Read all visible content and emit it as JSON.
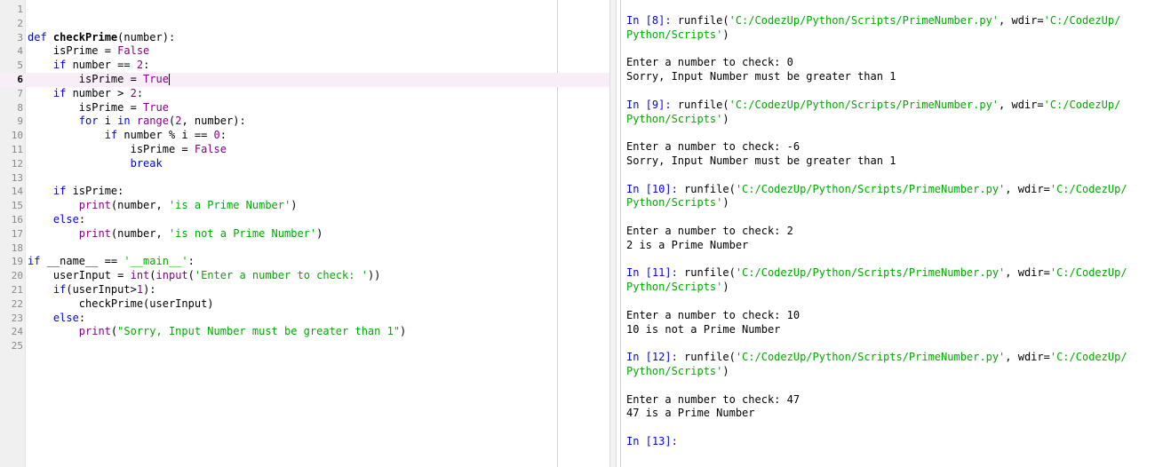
{
  "editor": {
    "lines": [
      {
        "n": "1",
        "parts": []
      },
      {
        "n": "2",
        "parts": []
      },
      {
        "n": "3",
        "parts": [
          [
            "kw",
            "def "
          ],
          [
            "fn",
            "checkPrime"
          ],
          [
            "t",
            "(number):"
          ]
        ]
      },
      {
        "n": "4",
        "parts": [
          [
            "t",
            "    isPrime = "
          ],
          [
            "bi",
            "False"
          ]
        ]
      },
      {
        "n": "5",
        "parts": [
          [
            "t",
            "    "
          ],
          [
            "kw",
            "if"
          ],
          [
            "t",
            " number == "
          ],
          [
            "num",
            "2"
          ],
          [
            "t",
            ":"
          ]
        ]
      },
      {
        "n": "6",
        "current": true,
        "parts": [
          [
            "t",
            "        isPrime = "
          ],
          [
            "bi",
            "True"
          ]
        ]
      },
      {
        "n": "7",
        "parts": [
          [
            "t",
            "    "
          ],
          [
            "kw",
            "if"
          ],
          [
            "t",
            " number > "
          ],
          [
            "num",
            "2"
          ],
          [
            "t",
            ":"
          ]
        ]
      },
      {
        "n": "8",
        "parts": [
          [
            "t",
            "        isPrime = "
          ],
          [
            "bi",
            "True"
          ]
        ]
      },
      {
        "n": "9",
        "parts": [
          [
            "t",
            "        "
          ],
          [
            "kw",
            "for"
          ],
          [
            "t",
            " i "
          ],
          [
            "kw",
            "in"
          ],
          [
            "t",
            " "
          ],
          [
            "bi",
            "range"
          ],
          [
            "t",
            "("
          ],
          [
            "num",
            "2"
          ],
          [
            "t",
            ", number):"
          ]
        ]
      },
      {
        "n": "10",
        "parts": [
          [
            "t",
            "            "
          ],
          [
            "kw",
            "if"
          ],
          [
            "t",
            " number % i == "
          ],
          [
            "num",
            "0"
          ],
          [
            "t",
            ":"
          ]
        ]
      },
      {
        "n": "11",
        "parts": [
          [
            "t",
            "                isPrime = "
          ],
          [
            "bi",
            "False"
          ]
        ]
      },
      {
        "n": "12",
        "parts": [
          [
            "t",
            "                "
          ],
          [
            "kw",
            "break"
          ]
        ]
      },
      {
        "n": "13",
        "parts": []
      },
      {
        "n": "14",
        "parts": [
          [
            "t",
            "    "
          ],
          [
            "kw",
            "if"
          ],
          [
            "t",
            " isPrime:"
          ]
        ]
      },
      {
        "n": "15",
        "parts": [
          [
            "t",
            "        "
          ],
          [
            "bi",
            "print"
          ],
          [
            "t",
            "(number, "
          ],
          [
            "str",
            "'is a Prime Number'"
          ],
          [
            "t",
            ")"
          ]
        ]
      },
      {
        "n": "16",
        "parts": [
          [
            "t",
            "    "
          ],
          [
            "kw",
            "else"
          ],
          [
            "t",
            ":"
          ]
        ]
      },
      {
        "n": "17",
        "parts": [
          [
            "t",
            "        "
          ],
          [
            "bi",
            "print"
          ],
          [
            "t",
            "(number, "
          ],
          [
            "str",
            "'is not a Prime Number'"
          ],
          [
            "t",
            ")"
          ]
        ]
      },
      {
        "n": "18",
        "parts": []
      },
      {
        "n": "19",
        "parts": [
          [
            "kw",
            "if"
          ],
          [
            "t",
            " __name__ == "
          ],
          [
            "str",
            "'__main__'"
          ],
          [
            "t",
            ":"
          ]
        ]
      },
      {
        "n": "20",
        "parts": [
          [
            "t",
            "    userInput = "
          ],
          [
            "bi",
            "int"
          ],
          [
            "t",
            "("
          ],
          [
            "bi",
            "input"
          ],
          [
            "t",
            "("
          ],
          [
            "str",
            "'Enter a number to check: '"
          ],
          [
            "t",
            "))"
          ]
        ]
      },
      {
        "n": "21",
        "parts": [
          [
            "t",
            "    "
          ],
          [
            "kw",
            "if"
          ],
          [
            "t",
            "(userInput>"
          ],
          [
            "num",
            "1"
          ],
          [
            "t",
            "):"
          ]
        ]
      },
      {
        "n": "22",
        "parts": [
          [
            "t",
            "        checkPrime(userInput)"
          ]
        ]
      },
      {
        "n": "23",
        "parts": [
          [
            "t",
            "    "
          ],
          [
            "kw",
            "else"
          ],
          [
            "t",
            ":"
          ]
        ]
      },
      {
        "n": "24",
        "parts": [
          [
            "t",
            "        "
          ],
          [
            "bi",
            "print"
          ],
          [
            "t",
            "("
          ],
          [
            "str",
            "\"Sorry, Input Number must be greater than 1\""
          ],
          [
            "t",
            ")"
          ]
        ]
      },
      {
        "n": "25",
        "parts": []
      }
    ]
  },
  "console": {
    "lines": [
      [
        [
          "p",
          "In [8]: "
        ],
        [
          "t",
          "runfile("
        ],
        [
          "s",
          "'C:/CodezUp/Python/Scripts/PrimeNumber.py'"
        ],
        [
          "t",
          ", wdir="
        ],
        [
          "s",
          "'C:/CodezUp/"
        ]
      ],
      [
        [
          "s",
          "Python/Scripts'"
        ],
        [
          "t",
          ")"
        ]
      ],
      [],
      [
        [
          "t",
          "Enter a number to check: 0"
        ]
      ],
      [
        [
          "t",
          "Sorry, Input Number must be greater than 1"
        ]
      ],
      [],
      [
        [
          "p",
          "In [9]: "
        ],
        [
          "t",
          "runfile("
        ],
        [
          "s",
          "'C:/CodezUp/Python/Scripts/PrimeNumber.py'"
        ],
        [
          "t",
          ", wdir="
        ],
        [
          "s",
          "'C:/CodezUp/"
        ]
      ],
      [
        [
          "s",
          "Python/Scripts'"
        ],
        [
          "t",
          ")"
        ]
      ],
      [],
      [
        [
          "t",
          "Enter a number to check: -6"
        ]
      ],
      [
        [
          "t",
          "Sorry, Input Number must be greater than 1"
        ]
      ],
      [],
      [
        [
          "p",
          "In [10]: "
        ],
        [
          "t",
          "runfile("
        ],
        [
          "s",
          "'C:/CodezUp/Python/Scripts/PrimeNumber.py'"
        ],
        [
          "t",
          ", wdir="
        ],
        [
          "s",
          "'C:/CodezUp/"
        ]
      ],
      [
        [
          "s",
          "Python/Scripts'"
        ],
        [
          "t",
          ")"
        ]
      ],
      [],
      [
        [
          "t",
          "Enter a number to check: 2"
        ]
      ],
      [
        [
          "t",
          "2 is a Prime Number"
        ]
      ],
      [],
      [
        [
          "p",
          "In [11]: "
        ],
        [
          "t",
          "runfile("
        ],
        [
          "s",
          "'C:/CodezUp/Python/Scripts/PrimeNumber.py'"
        ],
        [
          "t",
          ", wdir="
        ],
        [
          "s",
          "'C:/CodezUp/"
        ]
      ],
      [
        [
          "s",
          "Python/Scripts'"
        ],
        [
          "t",
          ")"
        ]
      ],
      [],
      [
        [
          "t",
          "Enter a number to check: 10"
        ]
      ],
      [
        [
          "t",
          "10 is not a Prime Number"
        ]
      ],
      [],
      [
        [
          "p",
          "In [12]: "
        ],
        [
          "t",
          "runfile("
        ],
        [
          "s",
          "'C:/CodezUp/Python/Scripts/PrimeNumber.py'"
        ],
        [
          "t",
          ", wdir="
        ],
        [
          "s",
          "'C:/CodezUp/"
        ]
      ],
      [
        [
          "s",
          "Python/Scripts'"
        ],
        [
          "t",
          ")"
        ]
      ],
      [],
      [
        [
          "t",
          "Enter a number to check: 47"
        ]
      ],
      [
        [
          "t",
          "47 is a Prime Number"
        ]
      ],
      [],
      [
        [
          "p",
          "In [13]: "
        ]
      ]
    ]
  }
}
